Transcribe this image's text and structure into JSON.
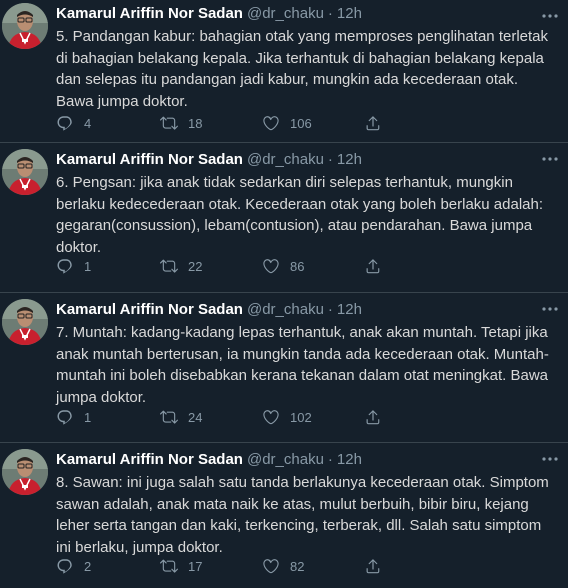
{
  "tweets": [
    {
      "name": "Kamarul Ariffin Nor Sadan",
      "handle": "@dr_chaku",
      "separator": "·",
      "time": "12h",
      "text": "5. Pandangan kabur: bahagian otak yang memproses penglihatan  terletak di bahagian belakang kepala. Jika terhantuk di bahagian belakang kepala dan selepas itu pandangan jadi kabur, mungkin ada kecederaan otak. Bawa jumpa doktor.",
      "replies": "4",
      "retweets": "18",
      "likes": "106"
    },
    {
      "name": "Kamarul Ariffin Nor Sadan",
      "handle": "@dr_chaku",
      "separator": "·",
      "time": "12h",
      "text": "6. Pengsan: jika anak tidak sedarkan diri selepas terhantuk, mungkin berlaku kedecederaan otak. Kecederaan otak yang boleh berlaku adalah: gegaran(consussion), lebam(contusion), atau pendarahan. Bawa jumpa doktor.",
      "replies": "1",
      "retweets": "22",
      "likes": "86"
    },
    {
      "name": "Kamarul Ariffin Nor Sadan",
      "handle": "@dr_chaku",
      "separator": "·",
      "time": "12h",
      "text": "7. Muntah: kadang-kadang lepas terhantuk, anak akan muntah. Tetapi jika anak muntah berterusan, ia mungkin tanda ada kecederaan otak. Muntah-muntah ini boleh disebabkan kerana tekanan dalam otat meningkat. Bawa jumpa doktor.",
      "replies": "1",
      "retweets": "24",
      "likes": "102"
    },
    {
      "name": "Kamarul Ariffin Nor Sadan",
      "handle": "@dr_chaku",
      "separator": "·",
      "time": "12h",
      "text": "8. Sawan: ini juga salah satu tanda berlakunya kecederaan otak. Simptom sawan adalah, anak mata naik ke atas, mulut berbuih, bibir biru, kejang leher serta tangan dan kaki, terkencing, terberak, dll. Salah satu simptom ini berlaku, jumpa doktor.",
      "replies": "2",
      "retweets": "17",
      "likes": "82"
    }
  ],
  "icons": {
    "reply": "reply-icon",
    "retweet": "retweet-icon",
    "like": "heart-icon",
    "share": "share-icon",
    "more": "more-icon"
  },
  "colors": {
    "background": "#15202b",
    "text": "#d9d9d9",
    "muted": "#8899a6",
    "divider": "#38444d"
  }
}
